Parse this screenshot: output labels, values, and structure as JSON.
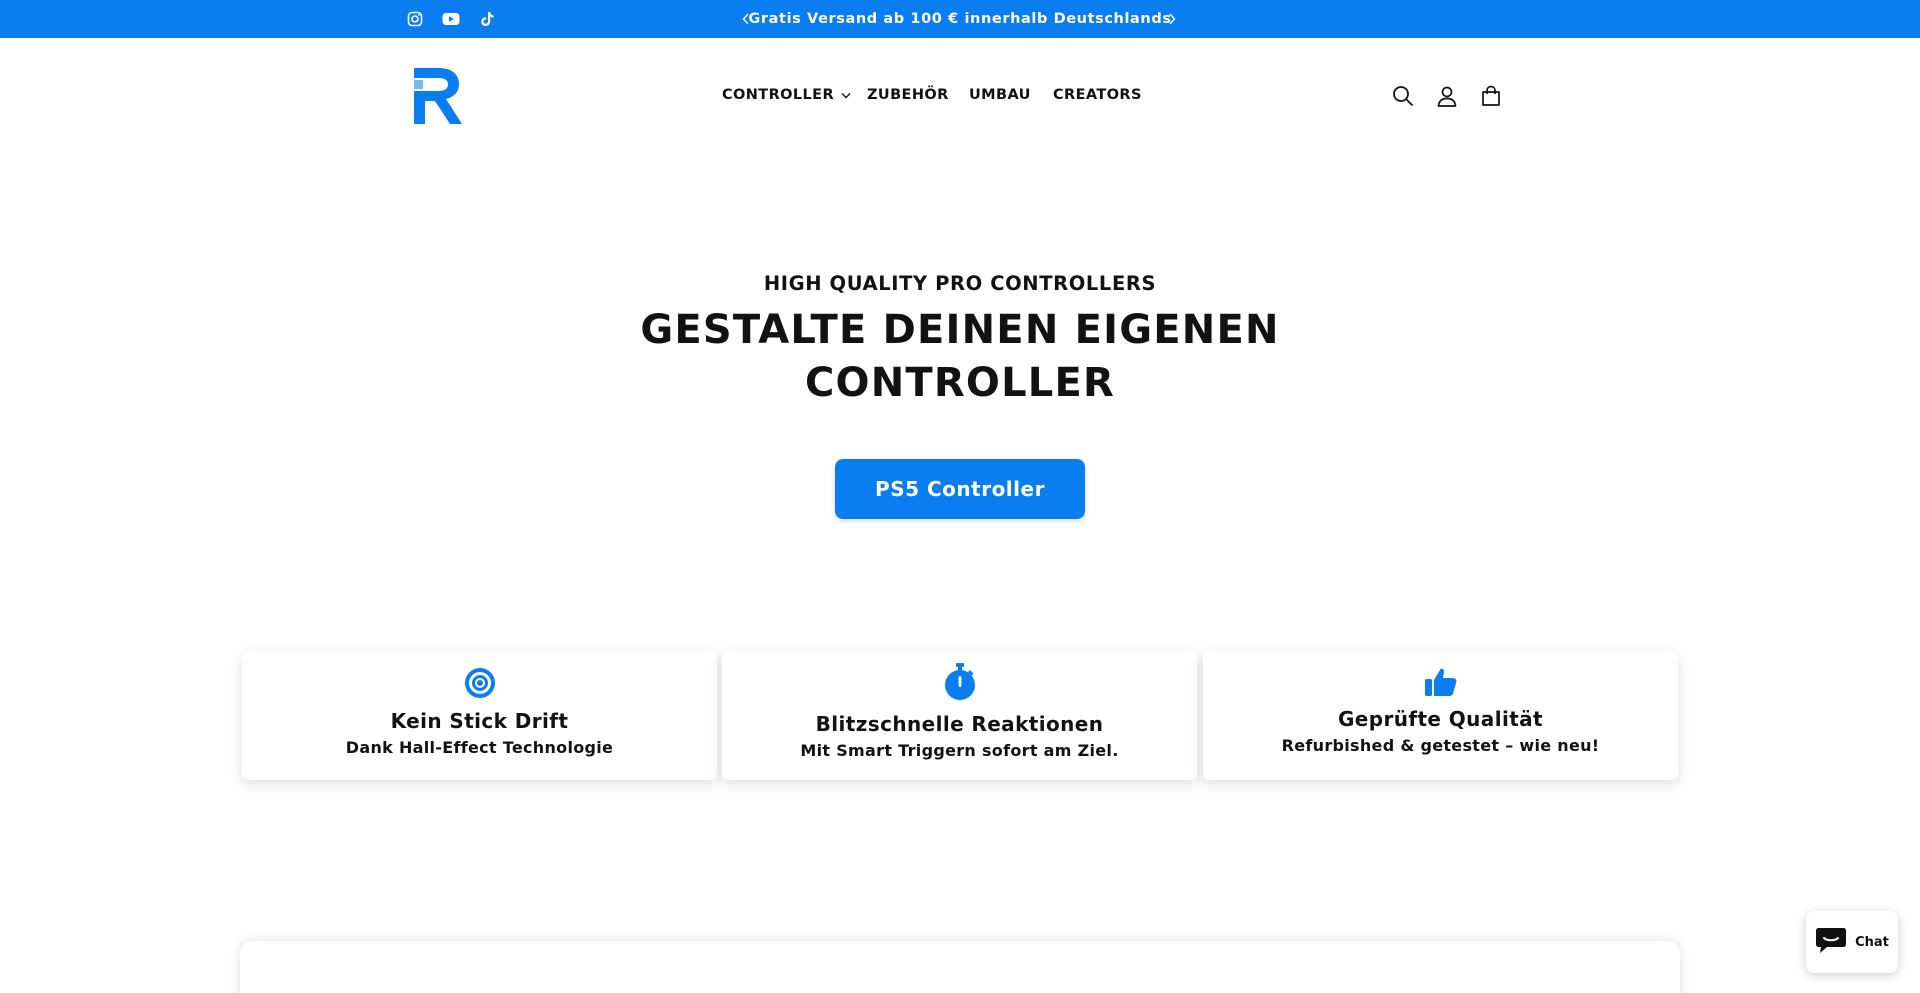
{
  "announcement": {
    "text": "Gratis Versand ab 100 € innerhalb Deutschlands",
    "background": "#0a7ef0"
  },
  "social": [
    "instagram-icon",
    "youtube-icon",
    "tiktok-icon"
  ],
  "nav": {
    "items": [
      {
        "label": "CONTROLLER",
        "has_dropdown": true
      },
      {
        "label": "ZUBEHÖR"
      },
      {
        "label": "UMBAU"
      },
      {
        "label": "CREATORS"
      }
    ]
  },
  "header_icons": [
    "search-icon",
    "account-icon",
    "cart-icon"
  ],
  "hero": {
    "subtitle": "HIGH QUALITY PRO CONTROLLERS",
    "title": "GESTALTE DEINEN EIGENEN CONTROLLER",
    "button_label": "PS5 Controller"
  },
  "features": [
    {
      "icon": "target-icon",
      "title": "Kein Stick Drift",
      "description": "Dank Hall-Effect Technologie"
    },
    {
      "icon": "stopwatch-icon",
      "title": "Blitzschnelle Reaktionen",
      "description": "Mit Smart Triggern sofort am Ziel."
    },
    {
      "icon": "thumbs-up-icon",
      "title": "Geprüfte Qualität",
      "description": "Refurbished & getestet – wie neu!"
    }
  ],
  "chat": {
    "label": "Chat"
  },
  "colors": {
    "accent": "#0a7ef0",
    "text": "#121212"
  }
}
